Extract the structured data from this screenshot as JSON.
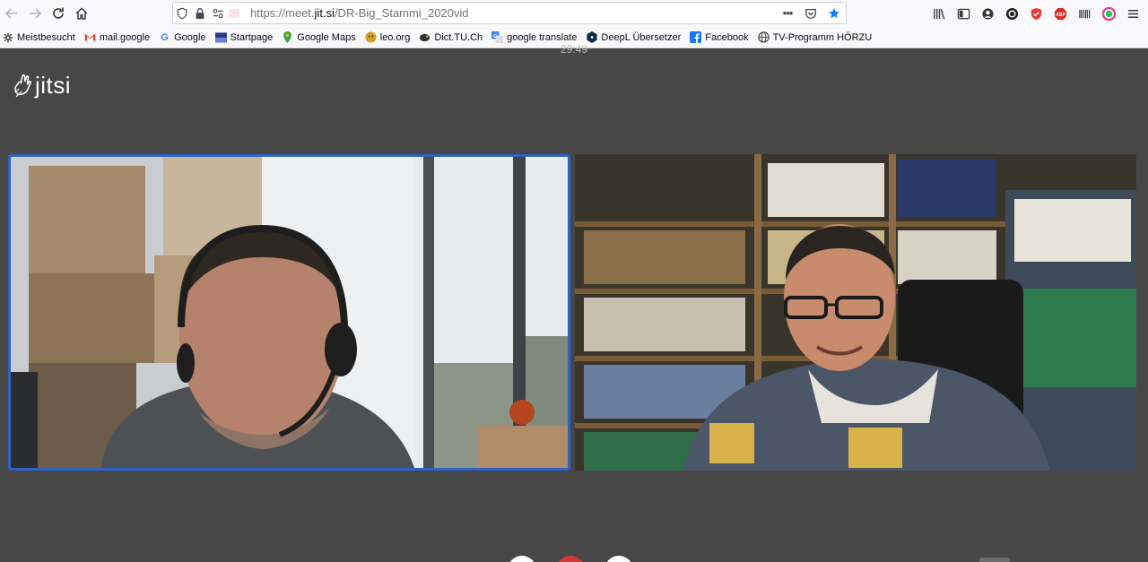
{
  "browser": {
    "url_prefix": "https://meet.",
    "url_domain": "jit.si",
    "url_path": "/DR-Big_Stammi_2020vid",
    "page_actions_more": "•••"
  },
  "bookmarks": [
    {
      "label": "Meistbesucht",
      "icon": "gear-icon",
      "color": "#3b3b3b"
    },
    {
      "label": "mail.google",
      "icon": "gmail-icon",
      "color": "#d93025"
    },
    {
      "label": "Google",
      "icon": "google-icon",
      "color": "#4285f4"
    },
    {
      "label": "Startpage",
      "icon": "startpage-icon",
      "color": "#2b3a8c"
    },
    {
      "label": "Google Maps",
      "icon": "maps-pin-icon",
      "color": "#34a853"
    },
    {
      "label": "leo.org",
      "icon": "leo-icon",
      "color": "#d4a017"
    },
    {
      "label": "Dict.TU.Ch",
      "icon": "dict-icon",
      "color": "#333333"
    },
    {
      "label": "google translate",
      "icon": "translate-icon",
      "color": "#4285f4"
    },
    {
      "label": "DeepL Übersetzer",
      "icon": "deepl-icon",
      "color": "#0f2b46"
    },
    {
      "label": "Facebook",
      "icon": "facebook-icon",
      "color": "#1877f2"
    },
    {
      "label": "TV-Programm HÖRZU",
      "icon": "globe-icon",
      "color": "#3b3b3b"
    }
  ],
  "meeting": {
    "timer": "29:49",
    "logo_text": "jitsi",
    "active_speaker_color": "#2d63c8"
  }
}
